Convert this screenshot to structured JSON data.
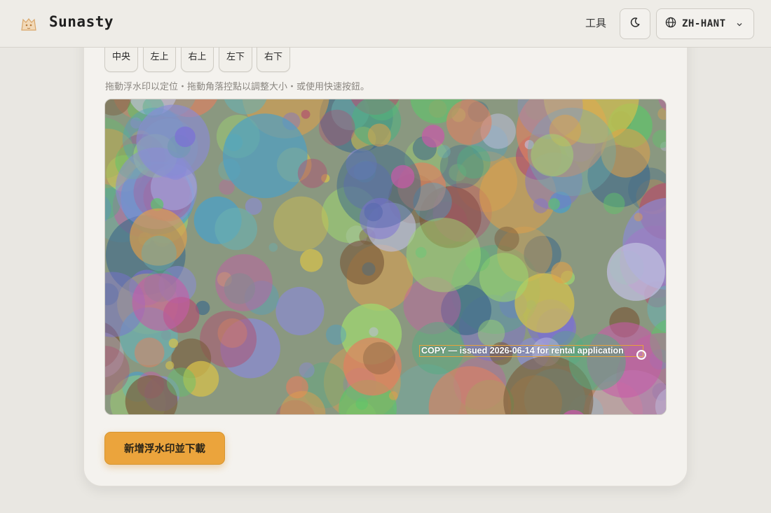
{
  "header": {
    "brand": "Sunasty",
    "nav_tools": "工具",
    "theme_icon": "moon-icon",
    "language": "ZH-HANT"
  },
  "position_buttons": [
    {
      "label": "中央"
    },
    {
      "label": "左上"
    },
    {
      "label": "右上"
    },
    {
      "label": "左下"
    },
    {
      "label": "右下"
    }
  ],
  "hint": "拖動浮水印以定位・拖動角落控點以調整大小・或使用快速按鈕。",
  "watermark": {
    "text": "COPY — issued 2026-06-14 for rental application",
    "box_color": "#e7a23a"
  },
  "submit_label": "新增浮水印並下載",
  "colors": {
    "accent": "#eba43c",
    "background": "#e9e7e2",
    "card": "#f4f2ee"
  }
}
